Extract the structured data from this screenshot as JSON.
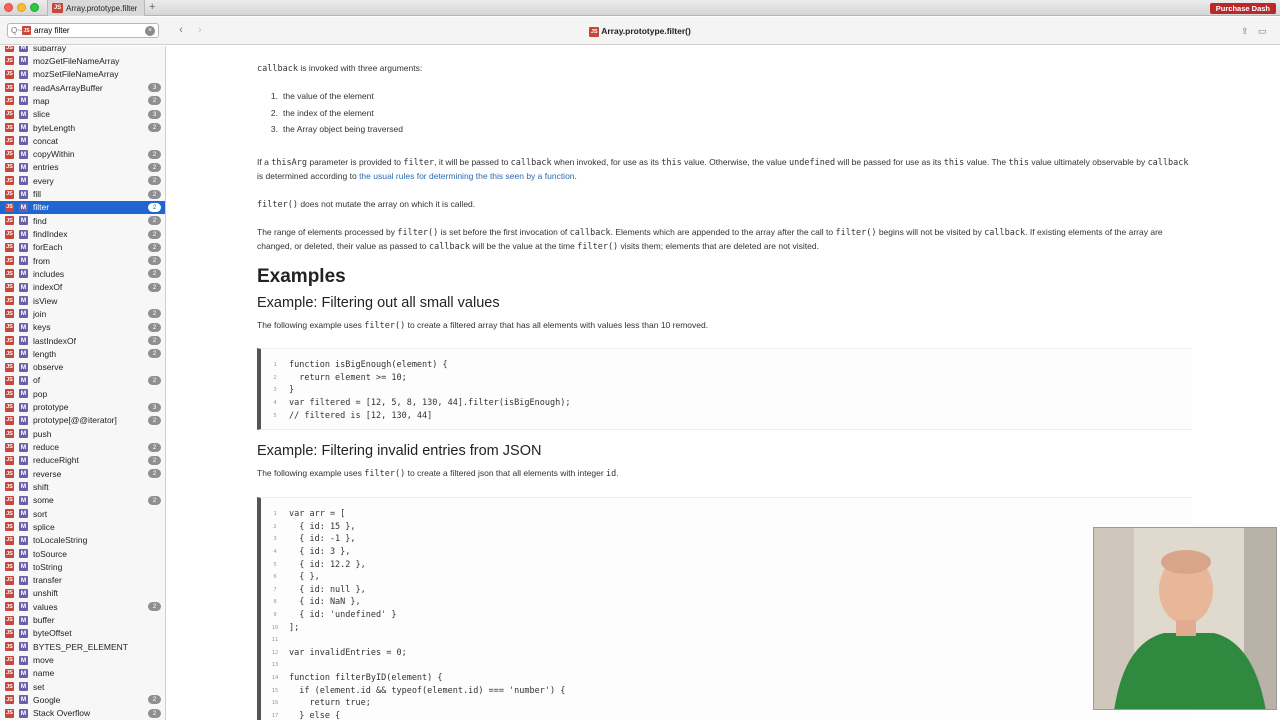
{
  "window": {
    "tab_title": "Array.prototype.filter",
    "tab_badge": "JS",
    "new_tab": "+",
    "purchase_label": "Purchase Dash"
  },
  "toolbar": {
    "search_prefix": "Q~",
    "search_value": "array filter",
    "doc_title": "Array.prototype.filter()",
    "doc_badge": "JS"
  },
  "sidebar": {
    "items": [
      {
        "label": "subarray",
        "count": ""
      },
      {
        "label": "mozGetFileNameArray",
        "count": ""
      },
      {
        "label": "mozSetFileNameArray",
        "count": ""
      },
      {
        "label": "readAsArrayBuffer",
        "count": "3"
      },
      {
        "label": "map",
        "count": "2"
      },
      {
        "label": "slice",
        "count": "3"
      },
      {
        "label": "byteLength",
        "count": "2"
      },
      {
        "label": "concat",
        "count": ""
      },
      {
        "label": "copyWithin",
        "count": "2"
      },
      {
        "label": "entries",
        "count": "2"
      },
      {
        "label": "every",
        "count": "2"
      },
      {
        "label": "fill",
        "count": "2"
      },
      {
        "label": "filter",
        "count": "2"
      },
      {
        "label": "find",
        "count": "2"
      },
      {
        "label": "findIndex",
        "count": "2"
      },
      {
        "label": "forEach",
        "count": "2"
      },
      {
        "label": "from",
        "count": "2"
      },
      {
        "label": "includes",
        "count": "2"
      },
      {
        "label": "indexOf",
        "count": "2"
      },
      {
        "label": "isView",
        "count": ""
      },
      {
        "label": "join",
        "count": "2"
      },
      {
        "label": "keys",
        "count": "2"
      },
      {
        "label": "lastIndexOf",
        "count": "2"
      },
      {
        "label": "length",
        "count": "2"
      },
      {
        "label": "observe",
        "count": ""
      },
      {
        "label": "of",
        "count": "2"
      },
      {
        "label": "pop",
        "count": ""
      },
      {
        "label": "prototype",
        "count": "3"
      },
      {
        "label": "prototype[@@iterator]",
        "count": "2"
      },
      {
        "label": "push",
        "count": ""
      },
      {
        "label": "reduce",
        "count": "2"
      },
      {
        "label": "reduceRight",
        "count": "2"
      },
      {
        "label": "reverse",
        "count": "2"
      },
      {
        "label": "shift",
        "count": ""
      },
      {
        "label": "some",
        "count": "2"
      },
      {
        "label": "sort",
        "count": ""
      },
      {
        "label": "splice",
        "count": ""
      },
      {
        "label": "toLocaleString",
        "count": ""
      },
      {
        "label": "toSource",
        "count": ""
      },
      {
        "label": "toString",
        "count": ""
      },
      {
        "label": "transfer",
        "count": ""
      },
      {
        "label": "unshift",
        "count": ""
      },
      {
        "label": "values",
        "count": "2"
      },
      {
        "label": "buffer",
        "count": ""
      },
      {
        "label": "byteOffset",
        "count": ""
      },
      {
        "label": "BYTES_PER_ELEMENT",
        "count": ""
      },
      {
        "label": "move",
        "count": ""
      },
      {
        "label": "name",
        "count": ""
      },
      {
        "label": "set",
        "count": ""
      },
      {
        "label": "Google",
        "count": "2"
      },
      {
        "label": "Stack Overflow",
        "count": "2"
      }
    ],
    "selected_index": 12,
    "type_badge": "JS",
    "method_badge": "M"
  },
  "doc": {
    "callback_intro_code": "callback",
    "callback_intro_rest": " is invoked with three arguments:",
    "args": [
      {
        "num": "1.",
        "text": "the value of the element"
      },
      {
        "num": "2.",
        "text": "the index of the element"
      },
      {
        "num": "3.",
        "text": "the Array object being traversed"
      }
    ],
    "thisarg_para": {
      "t1": "If a ",
      "c1": "thisArg",
      "t2": " parameter is provided to ",
      "c2": "filter",
      "t3": ", it will be passed to ",
      "c3": "callback",
      "t4": " when invoked, for use as its ",
      "c4": "this",
      "t5": " value.  Otherwise, the value ",
      "c5": "undefined",
      "t6": " will be passed for use as its ",
      "c6": "this",
      "t7": " value. The ",
      "c7": "this",
      "t8": " value ultimately observable by ",
      "c8": "callback",
      "t9": " is determined according to ",
      "link": "the usual rules for determining the this seen by a function",
      "t10": "."
    },
    "mutate_para": {
      "c1": "filter()",
      "t1": " does not mutate the array on which it is called."
    },
    "range_para": {
      "t1": "The range of elements processed by ",
      "c1": "filter()",
      "t2": " is set before the first invocation of ",
      "c2": "callback",
      "t3": ". Elements which are appended to the array after the call to ",
      "c3": "filter()",
      "t4": " begins will not be visited by ",
      "c4": "callback",
      "t5": ". If existing elements of the array are changed, or deleted, their value as passed to ",
      "c5": "callback",
      "t6": " will be the value at the time ",
      "c6": "filter()",
      "t7": " visits them; elements that are deleted are not visited."
    },
    "examples_heading": "Examples",
    "ex1_heading": "Example: Filtering out all small values",
    "ex1_desc_t1": "The following example uses ",
    "ex1_desc_c1": "filter()",
    "ex1_desc_t2": " to create a filtered array that has all elements with values less than 10 removed.",
    "ex1_code": [
      "function isBigEnough(element) {",
      "  return element >= 10;",
      "}",
      "var filtered = [12, 5, 8, 130, 44].filter(isBigEnough);",
      "// filtered is [12, 130, 44]"
    ],
    "ex2_heading": "Example: Filtering invalid entries from JSON",
    "ex2_desc_t1": "The following example uses ",
    "ex2_desc_c1": "filter()",
    "ex2_desc_t2": " to create a filtered json that all elements with integer ",
    "ex2_desc_c2": "id",
    "ex2_desc_t3": ".",
    "ex2_code": [
      "var arr = [",
      "  { id: 15 },",
      "  { id: -1 },",
      "  { id: 3 },",
      "  { id: 12.2 },",
      "  { },",
      "  { id: null },",
      "  { id: NaN },",
      "  { id: 'undefined' }",
      "];",
      "",
      "var invalidEntries = 0;",
      "",
      "function filterByID(element) {",
      "  if (element.id && typeof(element.id) === 'number') {",
      "    return true;",
      "  } else {"
    ]
  }
}
